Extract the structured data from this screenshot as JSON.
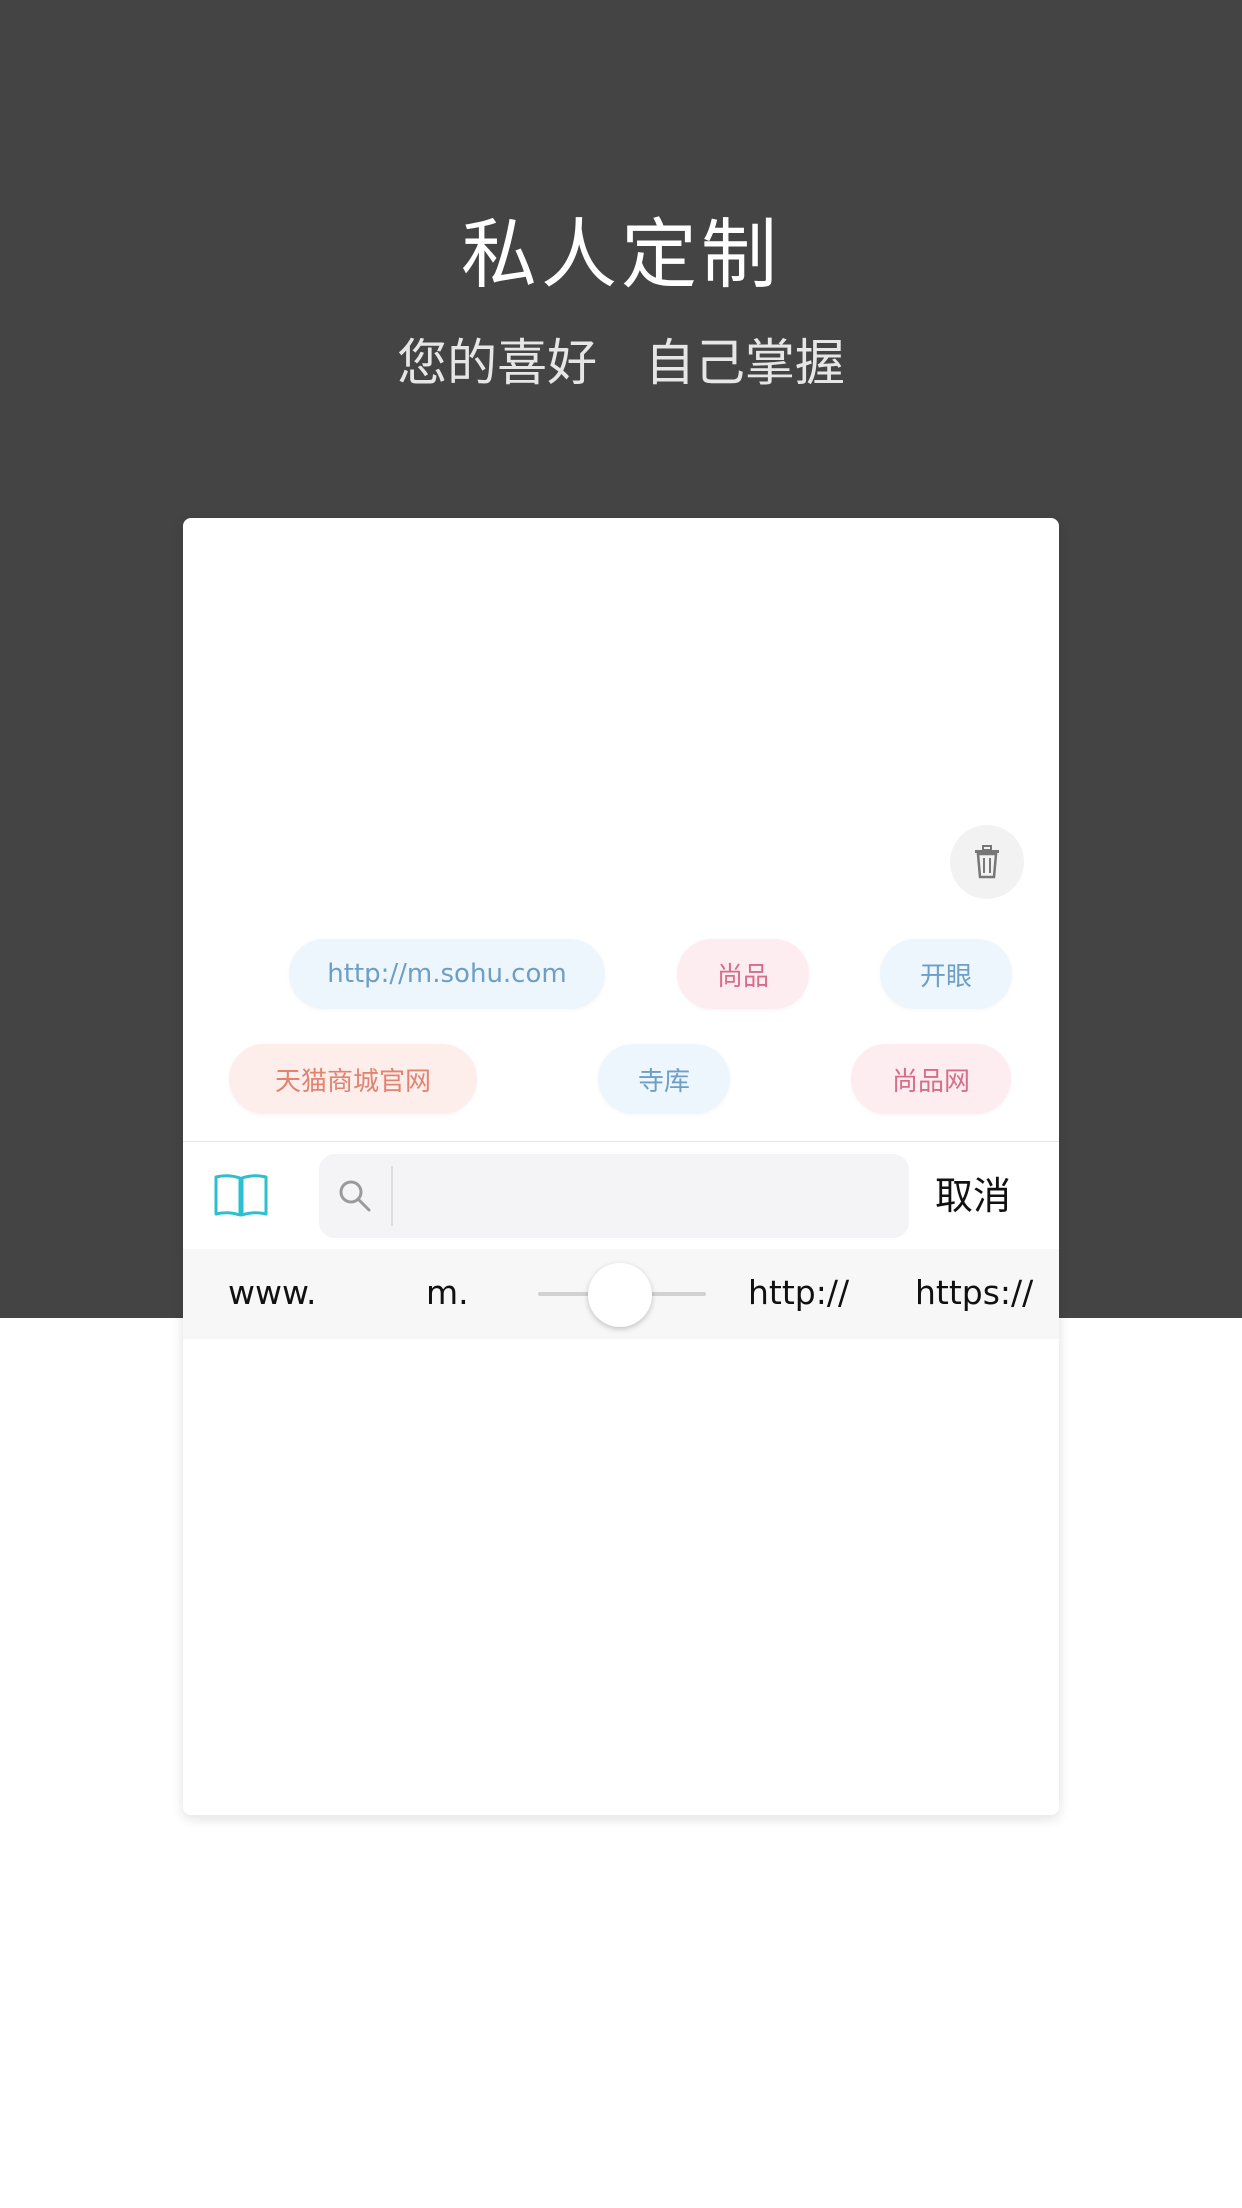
{
  "header": {
    "title": "私人定制",
    "subtitle": "您的喜好   自己掌握"
  },
  "tags": [
    {
      "label": "http://m.sohu.com",
      "style": "blue"
    },
    {
      "label": "尚品",
      "style": "pink"
    },
    {
      "label": "开眼",
      "style": "blue"
    },
    {
      "label": "天猫商城官网",
      "style": "orange"
    },
    {
      "label": "寺库",
      "style": "blue"
    },
    {
      "label": "尚品网",
      "style": "pink"
    }
  ],
  "search": {
    "value": "",
    "placeholder": "",
    "cancel_label": "取消"
  },
  "prefixes": {
    "items": [
      "www.",
      "m.",
      "http://",
      "https://"
    ]
  },
  "icons": {
    "trash": "trash-icon",
    "book": "book-icon",
    "search": "search-icon"
  },
  "colors": {
    "background_dark": "#444444",
    "accent": "#2bbfcf",
    "tag_blue_text": "#6c9ec6",
    "tag_pink_text": "#d46e8b",
    "tag_orange_text": "#e0846f"
  }
}
